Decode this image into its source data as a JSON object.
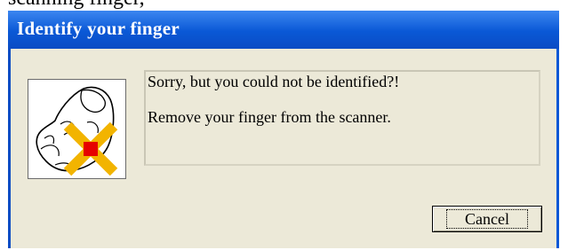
{
  "page_fragment_text": "scanning finger,",
  "window": {
    "title": "Identify your finger"
  },
  "icon": {
    "name": "fingerprint-failed-icon",
    "marker_color": "#e60000",
    "cross_color": "#f2b400"
  },
  "message": {
    "line1": "Sorry, but you could not be identified?!",
    "line2": "Remove your finger from the scanner."
  },
  "buttons": {
    "cancel_label": "Cancel"
  }
}
